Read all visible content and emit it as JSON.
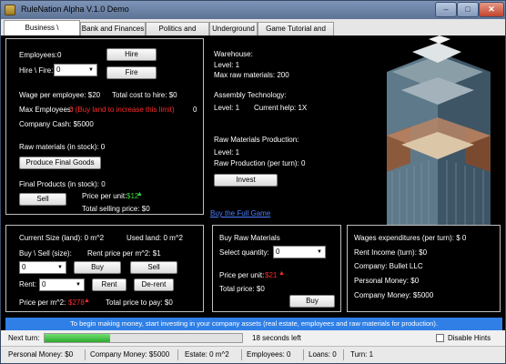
{
  "window": {
    "title": "RuleNation Alpha V.1.0 Demo"
  },
  "tabs": [
    "Business \\ Investments",
    "Bank and Finances",
    "Politics and Military",
    "Underground",
    "Game Tutorial and Help"
  ],
  "staff": {
    "employees_label": "Employees:",
    "employees_value": "0",
    "hire_button": "Hire",
    "hire_fire_label": "Hire \\ Fire:",
    "hire_fire_value": "0",
    "fire_button": "Fire",
    "wage_text": "Wage per employee: $20",
    "cost_text": "Total cost to hire: $0",
    "max_employees_label": "Max Employees:",
    "max_employees_hint": "0 (Buy land to increase this limit)",
    "max_employees_value": "0",
    "company_cash_text": "Company Cash: $5000",
    "raw_materials_text": "Raw materials (in stock):   0",
    "produce_button": "Produce Final Goods",
    "final_products_text": "Final Products (in stock):  0",
    "sell_button": "Sell",
    "price_label": "Price per unit:",
    "price_value": "$12",
    "total_selling_text": "Total selling price:  $0"
  },
  "warehouse": {
    "heading": "Warehouse:",
    "level": "Level: 1",
    "max_raw": "Max raw materials:  200",
    "assembly_heading": "Assembly Technology:",
    "assembly_level": "Level: 1",
    "current_help": "Current help: 1X",
    "rawprod_heading": "Raw Materials Production:",
    "rawprod_level": "Level: 1",
    "raw_production": "Raw Production (per turn):  0",
    "invest_button": "Invest",
    "full_game_link": "Buy the Full Game"
  },
  "land": {
    "current_size": "Current Size (land):    0 m^2",
    "used_land": "Used land:    0 m^2",
    "buy_sell_label": "Buy \\ Sell (size):",
    "rent_price_text": "Rent price per m^2: $1",
    "size_value": "0",
    "buy_button": "Buy",
    "sell_button": "Sell",
    "rent_label": "Rent:",
    "rent_value": "0",
    "rent_button": "Rent",
    "derent_button": "De-rent",
    "price_m2_label": "Price per m^2:",
    "price_m2_value": "$278",
    "total_pay_text": "Total price to pay:  $0"
  },
  "raw_buy": {
    "heading": "Buy Raw Materials",
    "select_label": "Select quantity:",
    "quantity_value": "0",
    "price_label": "Price per unit:",
    "price_value": "$21",
    "total_text": "Total price:    $0",
    "buy_button": "Buy"
  },
  "finance": {
    "wages_text": "Wages expenditures (per turn):  $ 0",
    "rent_income": "Rent Income (turn): $0",
    "company": "Company:  Bullet LLC",
    "personal_money": "Personal Money: $0",
    "company_money": "Company Money: $5000"
  },
  "message": "To begin making money, start investing in your company assets (real estate, employees and raw materials for production).",
  "turn": {
    "label": "Next turn:",
    "progress": 0.33,
    "seconds_text": "18 seconds left",
    "hints_label": "Disable Hints"
  },
  "status": {
    "personal": "Personal Money:   $0",
    "company": "Company Money:   $5000",
    "estate": "Estate:   0 m^2",
    "employees": "Employees:   0",
    "loans": "Loans:   0",
    "turn": "Turn:   1"
  },
  "colors": {
    "accent": "#2f7fe6",
    "warning": "#ff2a2a",
    "progress": "#3bc23b"
  }
}
